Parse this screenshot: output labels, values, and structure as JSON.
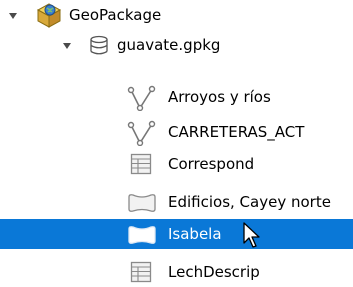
{
  "tree": {
    "root": {
      "label": "GeoPackage",
      "icon": "geopackage-icon",
      "expanded": true
    },
    "file": {
      "label": "guavate.gpkg",
      "icon": "database-icon",
      "expanded": true
    },
    "layers": [
      {
        "label": "Arroyos y ríos",
        "icon": "line-layer-icon"
      },
      {
        "label": "CARRETERAS_ACT",
        "icon": "line-layer-icon"
      },
      {
        "label": "Correspond",
        "icon": "table-layer-icon"
      },
      {
        "label": "Edificios, Cayey norte",
        "icon": "polygon-layer-icon"
      },
      {
        "label": "Isabela",
        "icon": "polygon-layer-icon",
        "selected": true
      },
      {
        "label": "LechDescrip",
        "icon": "table-layer-icon"
      }
    ]
  },
  "colors": {
    "selection": "#0a78d7",
    "selection_text": "#ffffff"
  }
}
